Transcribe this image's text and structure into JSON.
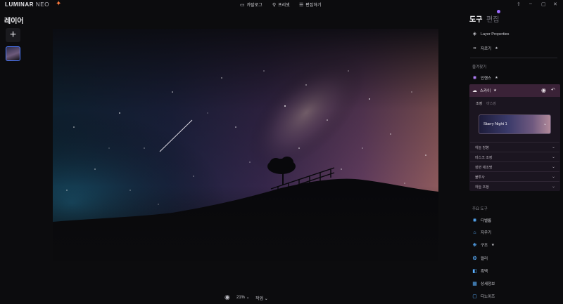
{
  "app": {
    "logo_text": "LUMINAR",
    "logo_suffix": "NEO"
  },
  "nav": {
    "catalog": "카탈로그",
    "presets": "프리셋",
    "edit": "편집하기"
  },
  "left_panel": {
    "title": "레이어",
    "add_icon": "plus-icon"
  },
  "bottom_bar": {
    "zoom": "21%",
    "task": "작업"
  },
  "right_panel": {
    "tab_tools": "도구",
    "tab_edit": "편집",
    "layer_properties": "Layer Properties",
    "crop": "자르기",
    "favorites_title": "즐겨찾기",
    "enhance": "인핸스",
    "sky": {
      "title": "스카이",
      "tab_adjust": "조정",
      "tab_masking": "마스킹",
      "selected_sky": "Starry Night 1",
      "sections": [
        "하늘 방향",
        "마스크 조정",
        "장면 재조명",
        "불투사",
        "하늘 조정"
      ]
    },
    "essentials_title": "주요 도구",
    "tools": [
      "디벨롭",
      "지우기",
      "구조",
      "컬러",
      "흑백",
      "상세정보",
      "디노이즈"
    ]
  },
  "colors": {
    "accent_blue": "#4d7bff",
    "sky_header": "#3a2237",
    "badge": "#9b6bff"
  }
}
